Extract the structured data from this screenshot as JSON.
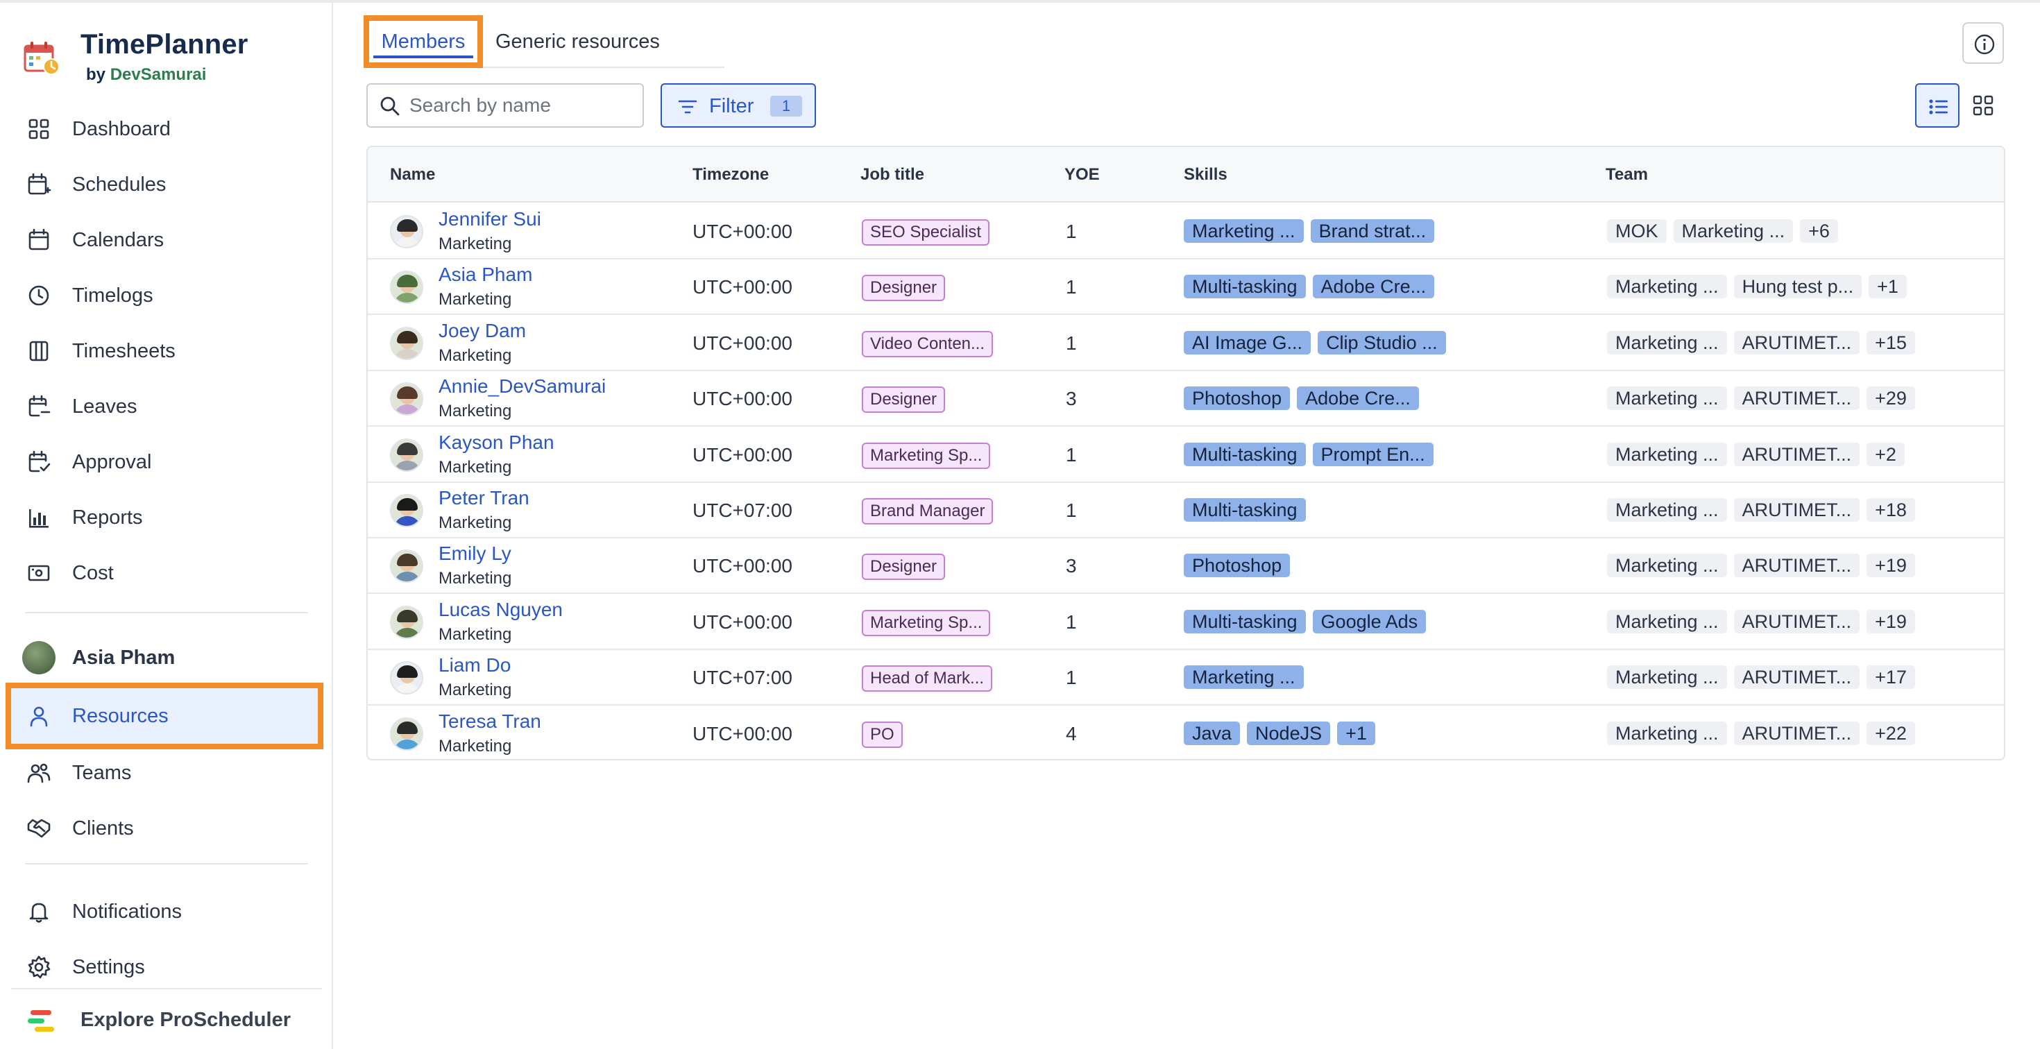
{
  "app": {
    "name": "TimePlanner",
    "by_prefix": "by",
    "by_brand": "DevSamurai"
  },
  "sidebar": {
    "items": [
      {
        "label": "Dashboard",
        "icon": "dashboard-icon"
      },
      {
        "label": "Schedules",
        "icon": "schedules-icon"
      },
      {
        "label": "Calendars",
        "icon": "calendar-icon"
      },
      {
        "label": "Timelogs",
        "icon": "clock-icon"
      },
      {
        "label": "Timesheets",
        "icon": "timesheet-icon"
      },
      {
        "label": "Leaves",
        "icon": "leaves-icon"
      },
      {
        "label": "Approval",
        "icon": "approval-icon"
      },
      {
        "label": "Reports",
        "icon": "reports-icon"
      },
      {
        "label": "Cost",
        "icon": "cost-icon"
      }
    ],
    "user": {
      "name": "Asia Pham"
    },
    "people_items": [
      {
        "label": "Resources",
        "icon": "person-icon",
        "active": true
      },
      {
        "label": "Teams",
        "icon": "teams-icon"
      },
      {
        "label": "Clients",
        "icon": "handshake-icon"
      }
    ],
    "bottom_items": [
      {
        "label": "Notifications",
        "icon": "bell-icon"
      },
      {
        "label": "Settings",
        "icon": "gear-icon"
      }
    ],
    "explore": {
      "label": "Explore ProScheduler"
    }
  },
  "tabs": [
    {
      "label": "Members",
      "active": true
    },
    {
      "label": "Generic resources",
      "active": false
    }
  ],
  "toolbar": {
    "search_placeholder": "Search by name",
    "filter_label": "Filter",
    "filter_count": "1"
  },
  "table": {
    "headers": {
      "name": "Name",
      "timezone": "Timezone",
      "job_title": "Job title",
      "yoe": "YOE",
      "skills": "Skills",
      "team": "Team"
    },
    "rows": [
      {
        "name": "Jennifer Sui",
        "dept": "Marketing",
        "tz": "UTC+00:00",
        "job": "SEO Specialist",
        "yoe": "1",
        "skills": [
          "Marketing ...",
          "Brand strat..."
        ],
        "teams": [
          "MOK",
          "Marketing ...",
          "+6"
        ]
      },
      {
        "name": "Asia Pham",
        "dept": "Marketing",
        "tz": "UTC+00:00",
        "job": "Designer",
        "yoe": "1",
        "skills": [
          "Multi-tasking",
          "Adobe Cre..."
        ],
        "teams": [
          "Marketing ...",
          "Hung test p...",
          "+1"
        ]
      },
      {
        "name": "Joey Dam",
        "dept": "Marketing",
        "tz": "UTC+00:00",
        "job": "Video Conten...",
        "yoe": "1",
        "skills": [
          "AI Image G...",
          "Clip Studio ..."
        ],
        "teams": [
          "Marketing ...",
          "ARUTIMET...",
          "+15"
        ]
      },
      {
        "name": "Annie_DevSamurai",
        "dept": "Marketing",
        "tz": "UTC+00:00",
        "job": "Designer",
        "yoe": "3",
        "skills": [
          "Photoshop",
          "Adobe Cre..."
        ],
        "teams": [
          "Marketing ...",
          "ARUTIMET...",
          "+29"
        ]
      },
      {
        "name": "Kayson Phan",
        "dept": "Marketing",
        "tz": "UTC+00:00",
        "job": "Marketing Sp...",
        "yoe": "1",
        "skills": [
          "Multi-tasking",
          "Prompt En..."
        ],
        "teams": [
          "Marketing ...",
          "ARUTIMET...",
          "+2"
        ]
      },
      {
        "name": "Peter Tran",
        "dept": "Marketing",
        "tz": "UTC+07:00",
        "job": "Brand Manager",
        "yoe": "1",
        "skills": [
          "Multi-tasking"
        ],
        "teams": [
          "Marketing ...",
          "ARUTIMET...",
          "+18"
        ]
      },
      {
        "name": "Emily Ly",
        "dept": "Marketing",
        "tz": "UTC+00:00",
        "job": "Designer",
        "yoe": "3",
        "skills": [
          "Photoshop"
        ],
        "teams": [
          "Marketing ...",
          "ARUTIMET...",
          "+19"
        ]
      },
      {
        "name": "Lucas Nguyen",
        "dept": "Marketing",
        "tz": "UTC+00:00",
        "job": "Marketing Sp...",
        "yoe": "1",
        "skills": [
          "Multi-tasking",
          "Google Ads"
        ],
        "teams": [
          "Marketing ...",
          "ARUTIMET...",
          "+19"
        ]
      },
      {
        "name": "Liam Do",
        "dept": "Marketing",
        "tz": "UTC+07:00",
        "job": "Head of Mark...",
        "yoe": "1",
        "skills": [
          "Marketing ..."
        ],
        "teams": [
          "Marketing ...",
          "ARUTIMET...",
          "+17"
        ]
      },
      {
        "name": "Teresa Tran",
        "dept": "Marketing",
        "tz": "UTC+00:00",
        "job": "PO",
        "yoe": "4",
        "skills": [
          "Java",
          "NodeJS",
          "+1"
        ],
        "teams": [
          "Marketing ...",
          "ARUTIMET...",
          "+22"
        ]
      }
    ]
  },
  "colors": {
    "accent": "#2a56c6",
    "highlight": "#f28c28",
    "skill_bg": "#8fb1ea",
    "job_border": "#c47fd6",
    "job_bg": "#f6e6fb"
  }
}
